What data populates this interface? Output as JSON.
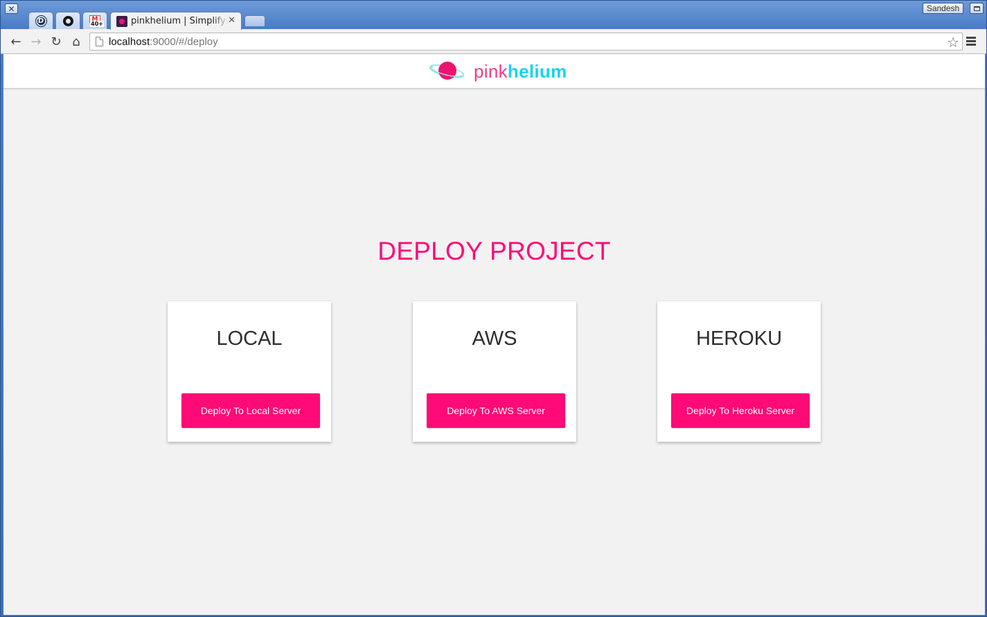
{
  "window": {
    "profile_name": "Sandesh",
    "close_glyph": "✕"
  },
  "tabs": [
    {
      "kind": "pinned",
      "icon": "disqus-icon",
      "letter": "D"
    },
    {
      "kind": "pinned",
      "icon": "github-icon"
    },
    {
      "kind": "pinned",
      "icon": "gmail-icon",
      "letter": "M",
      "badge": "40+"
    },
    {
      "kind": "active",
      "icon": "pinkhelium-favicon",
      "title": "pinkhelium | Simplifying",
      "close": "✕"
    }
  ],
  "toolbar": {
    "back": "←",
    "forward": "→",
    "reload": "↻",
    "home": "⌂",
    "url_host": "localhost",
    "url_rest": ":9000/#/deploy",
    "star": "☆"
  },
  "app": {
    "logo_pink": "pink",
    "logo_cyan": "helium",
    "heading": "DEPLOY PROJECT",
    "colors": {
      "accent": "#ff0a76",
      "logo_cyan": "#16d4f1",
      "logo_pink": "#ef3d85",
      "background": "#f2f2f2"
    },
    "cards": [
      {
        "title": "LOCAL",
        "button": "Deploy To Local Server"
      },
      {
        "title": "AWS",
        "button": "Deploy To AWS Server"
      },
      {
        "title": "HEROKU",
        "button": "Deploy To Heroku Server"
      }
    ]
  }
}
